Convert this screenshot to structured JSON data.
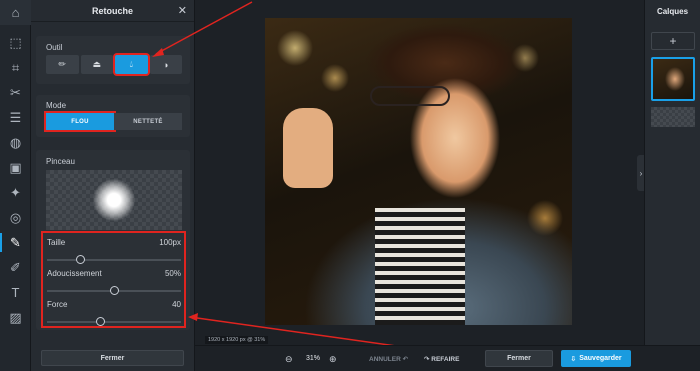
{
  "rail": {
    "icons": [
      "home-icon",
      "pointer-icon",
      "crop-icon",
      "cut-icon",
      "adjust-icon",
      "filter-icon",
      "effects-icon",
      "spiral-icon",
      "retouch-icon",
      "brush-icon",
      "text-icon",
      "pattern-icon"
    ]
  },
  "panel": {
    "title": "Retouche",
    "close_glyph": "✕",
    "outil_label": "Outil",
    "mode_label": "Mode",
    "mode_options": [
      "FLOU",
      "NETTETÉ"
    ],
    "pinceau_label": "Pinceau",
    "sliders": [
      {
        "name": "Taille",
        "value": "100px",
        "level": 0.25
      },
      {
        "name": "Adoucissement",
        "value": "50%",
        "level": 0.5
      },
      {
        "name": "Force",
        "value": "40",
        "level": 0.4
      }
    ],
    "close_button": "Fermer"
  },
  "canvas": {
    "dimensions": "1920 x 1920 px @ 31%"
  },
  "layers": {
    "title": "Calques",
    "add_glyph": "+"
  },
  "bottom": {
    "zoom_out": "⊖",
    "zoom_value": "31%",
    "zoom_in": "⊕",
    "undo": "ANNULER ↶",
    "redo": "↷ REFAIRE",
    "close": "Fermer",
    "save": "Sauvegarder"
  },
  "colors": {
    "accent": "#1a9bdf",
    "highlight": "#e0241f"
  }
}
